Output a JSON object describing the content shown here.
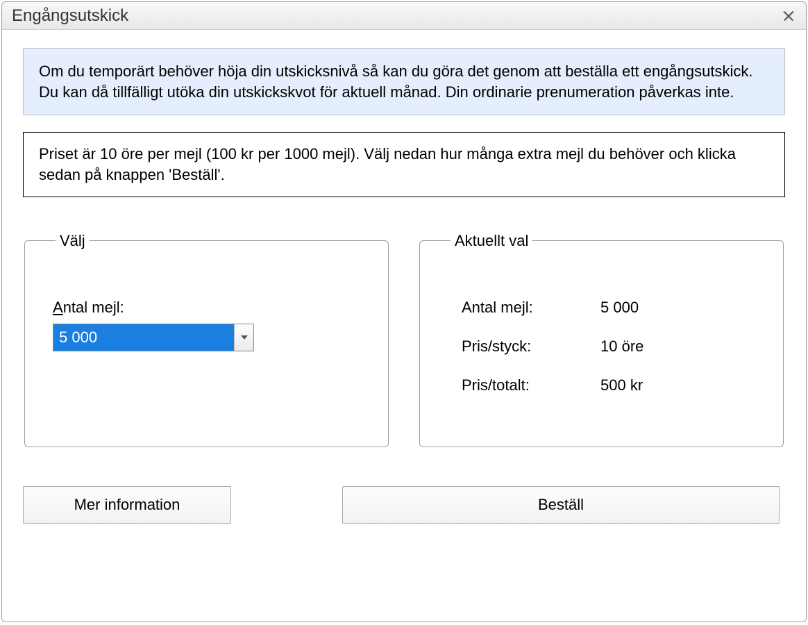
{
  "window": {
    "title": "Engångsutskick"
  },
  "info": "Om du temporärt behöver höja din utskicksnivå så kan du göra det genom att beställa ett engångsutskick. Du kan då tillfälligt utöka din utskickskvot för aktuell månad. Din ordinarie prenumeration påverkas inte.",
  "price_text": "Priset är 10 öre per mejl (100 kr per 1000 mejl). Välj nedan hur många extra mejl du behöver och klicka sedan på knappen 'Beställ'.",
  "select_panel": {
    "legend": "Välj",
    "label_rest": "ntal mejl:",
    "label_first": "A",
    "combo_value": "5 000"
  },
  "current_panel": {
    "legend": "Aktuellt val",
    "rows": {
      "qty_label": "Antal mejl:",
      "qty_value": "5 000",
      "unit_label": "Pris/styck:",
      "unit_value": "10 öre",
      "total_label": "Pris/totalt:",
      "total_value": "500 kr"
    }
  },
  "buttons": {
    "more_info": "Mer information",
    "order": "Beställ"
  }
}
